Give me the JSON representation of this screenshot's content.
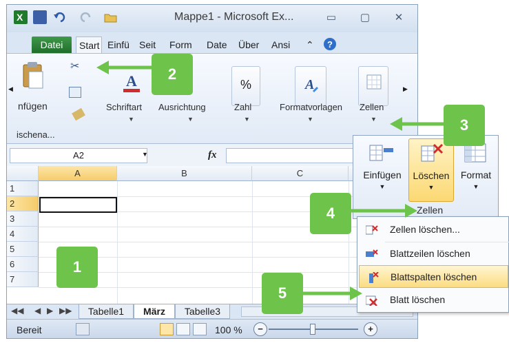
{
  "titlebar": {
    "title": "Mappe1  -  Microsoft Ex...",
    "minimize": "▭",
    "maximize": "▢",
    "close": "✕"
  },
  "tabs": [
    "Datei",
    "Start",
    "Einfü",
    "Seit",
    "Form",
    "Date",
    "Über",
    "Ansi"
  ],
  "ribbon": {
    "paste_label": "nfügen",
    "clipboard_group": "ischena...",
    "font_label": "Schriftart",
    "align_label": "Ausrichtung",
    "number_label": "Zahl",
    "percent_glyph": "%",
    "styles_label": "Formatvorlagen",
    "cells_label": "Zellen"
  },
  "formula_bar": {
    "namebox": "A2",
    "fx": "fx"
  },
  "grid": {
    "columns": [
      "A",
      "B",
      "C"
    ],
    "rows": [
      "1",
      "2",
      "3",
      "4",
      "5",
      "6",
      "7"
    ],
    "active_cell": "A2"
  },
  "sheets": [
    "Tabelle1",
    "März",
    "Tabelle3"
  ],
  "status": {
    "ready": "Bereit",
    "zoom": "100 %"
  },
  "zellen_panel": {
    "insert": "Einfügen",
    "delete": "Löschen",
    "format": "Format",
    "group_label": "Zellen"
  },
  "dropdown": {
    "items": [
      "Zellen löschen...",
      "Blattzeilen löschen",
      "Blattspalten löschen",
      "Blatt löschen"
    ]
  },
  "callouts": [
    "1",
    "2",
    "3",
    "4",
    "5"
  ],
  "colors": {
    "callout": "#6ec34a",
    "excel_green": "#1f6e2a",
    "highlight": "#fbd873"
  }
}
